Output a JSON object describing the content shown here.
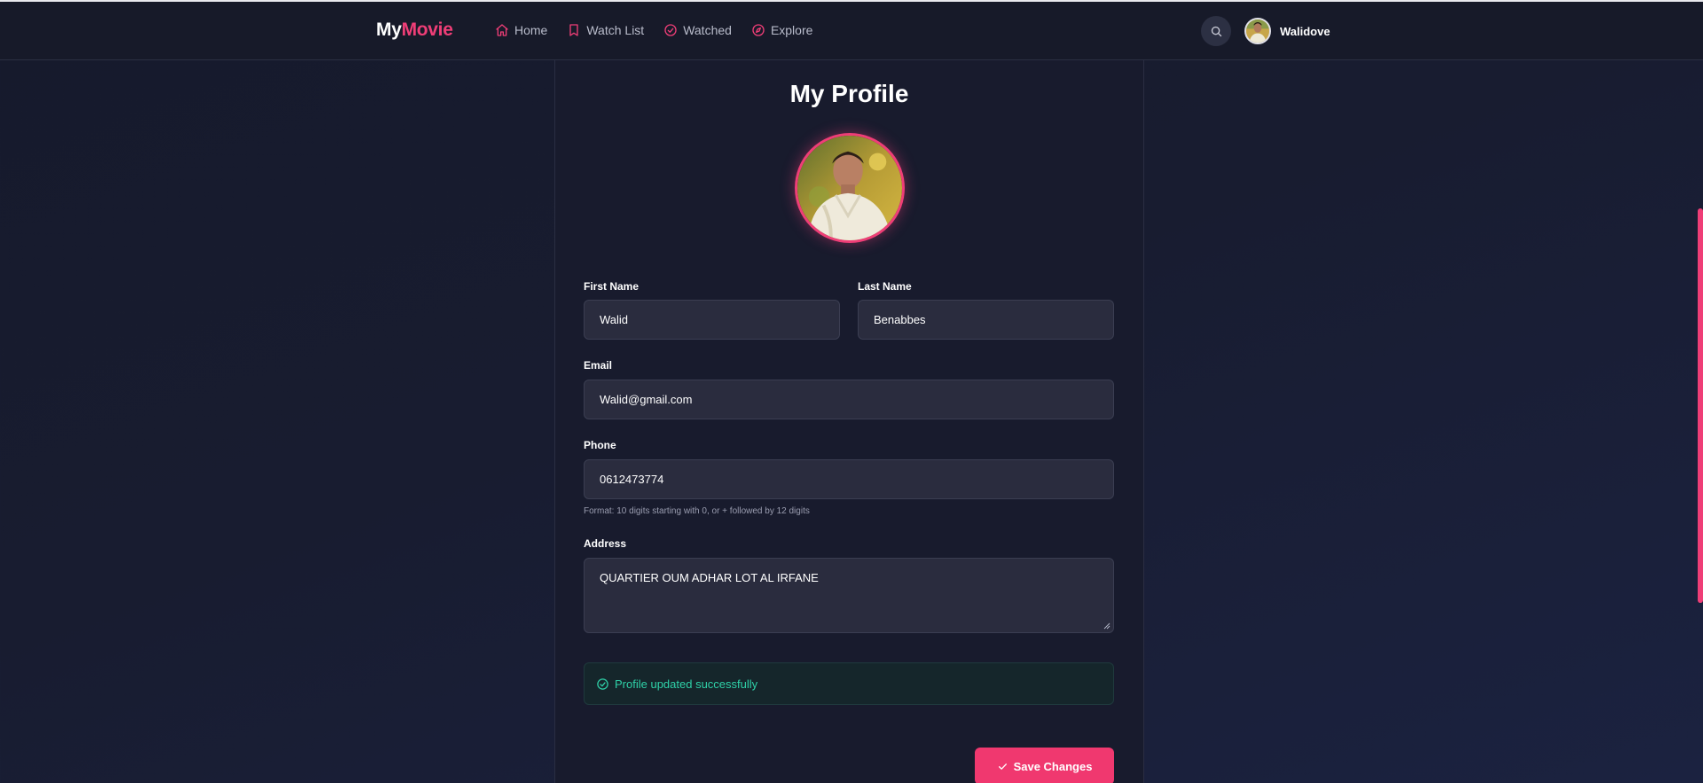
{
  "app": {
    "logo_part1": "My",
    "logo_part2": "Movie"
  },
  "nav": {
    "items": [
      {
        "label": "Home",
        "icon": "home-icon"
      },
      {
        "label": "Watch List",
        "icon": "bookmark-icon"
      },
      {
        "label": "Watched",
        "icon": "check-circle-icon"
      },
      {
        "label": "Explore",
        "icon": "compass-icon"
      }
    ],
    "search_icon": "search-icon",
    "user_name": "Walidove"
  },
  "profile": {
    "title": "My Profile",
    "first_name": {
      "label": "First Name",
      "value": "Walid"
    },
    "last_name": {
      "label": "Last Name",
      "value": "Benabbes"
    },
    "email": {
      "label": "Email",
      "value": "Walid@gmail.com"
    },
    "phone": {
      "label": "Phone",
      "value": "0612473774",
      "hint": "Format: 10 digits starting with 0, or + followed by 12 digits"
    },
    "address": {
      "label": "Address",
      "value": "QUARTIER OUM ADHAR LOT AL IRFANE"
    },
    "success_message": "Profile updated successfully",
    "save_label": "Save Changes"
  },
  "colors": {
    "accent": "#ef3e77",
    "success": "#2fd1a8",
    "background": "#181b2d"
  }
}
